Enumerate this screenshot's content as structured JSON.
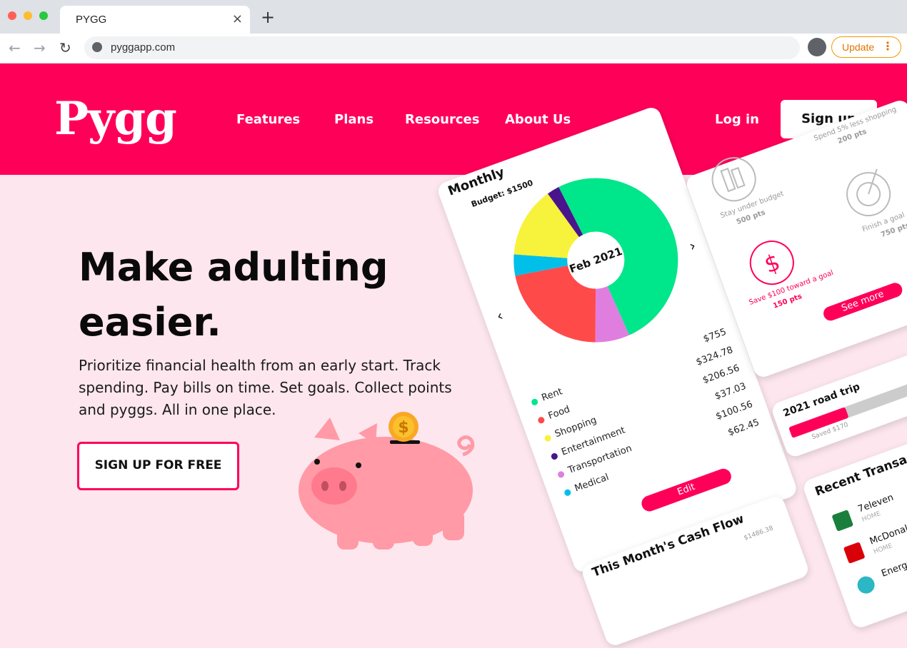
{
  "browser": {
    "tab_title": "PYGG",
    "url": "pyggapp.com",
    "update_label": "Update",
    "tab_close": "×",
    "new_tab": "+",
    "back": "←",
    "forward": "→",
    "reload": "↻",
    "menu_dots": "⋮"
  },
  "header": {
    "logo": "Pygg",
    "nav": [
      "Features",
      "Plans",
      "Resources",
      "About Us"
    ],
    "login": "Log in",
    "signup": "Sign up"
  },
  "hero": {
    "title_line1": "Make adulting",
    "title_line2": "easier.",
    "description": "Prioritize financial health from an early start. Track spending. Pay bills on time. Set goals. Collect points and pyggs. All in one place.",
    "cta": "SIGN UP FOR FREE"
  },
  "budget_card": {
    "title": "Monthly",
    "budget": "Budget: $1500",
    "center_label": "Feb 2021",
    "prev": "‹",
    "next": "›",
    "categories": [
      {
        "name": "Rent",
        "amount": "$755",
        "color": "#00e68a"
      },
      {
        "name": "Food",
        "amount": "$324.78",
        "color": "#ff4a4a"
      },
      {
        "name": "Shopping",
        "amount": "$206.56",
        "color": "#f7f23b"
      },
      {
        "name": "Entertainment",
        "amount": "$37.03",
        "color": "#4a148c"
      },
      {
        "name": "Transportation",
        "amount": "$100.56",
        "color": "#e07ee0"
      },
      {
        "name": "Medical",
        "amount": "$62.45",
        "color": "#00bfe8"
      }
    ],
    "edit": "Edit"
  },
  "rewards_card": {
    "items": [
      {
        "label": "Stay under budget",
        "pts": "500 pts"
      },
      {
        "label": "Spend 5% less shopping",
        "pts": "200 pts"
      },
      {
        "label": "Save $100 toward a goal",
        "pts": "150 pts"
      },
      {
        "label": "Finish a goal",
        "pts": "750 pts"
      }
    ],
    "see_more": "See more",
    "dollar": "$"
  },
  "goal_card": {
    "title": "2021 road trip",
    "saved": "Saved $170",
    "progress_fraction": 0.4
  },
  "transactions_card": {
    "title": "Recent Transactions",
    "items": [
      {
        "name": "7eleven",
        "category": "HOME"
      },
      {
        "name": "McDonald's",
        "category": "HOME"
      },
      {
        "name": "Energy",
        "category": ""
      }
    ]
  },
  "cashflow_card": {
    "title": "This Month's Cash Flow",
    "value": "$1486.38"
  },
  "pig": {
    "coin": "$"
  },
  "colors": {
    "brand": "#ff0059",
    "hero_bg": "#fde6ee",
    "pig": "#ff9aa6"
  }
}
